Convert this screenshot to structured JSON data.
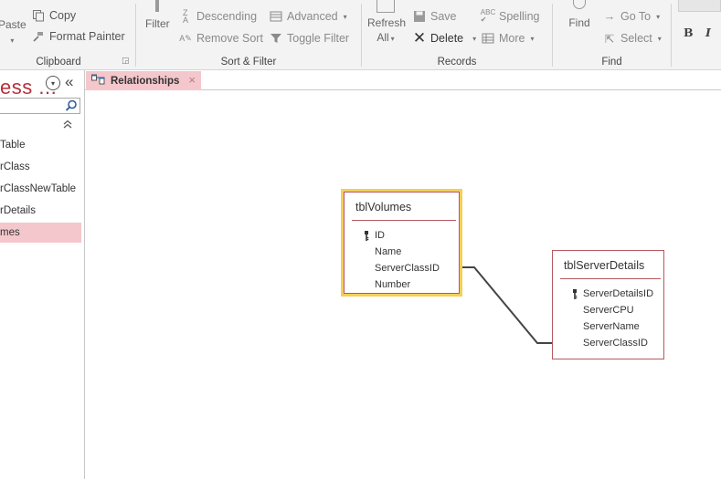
{
  "ribbon": {
    "clipboard": {
      "paste_label": "Paste",
      "copy_label": "Copy",
      "format_painter_label": "Format Painter",
      "group_label": "Clipboard"
    },
    "sort_filter": {
      "filter_label": "Filter",
      "descending_label": "Descending",
      "remove_sort_label": "Remove Sort",
      "advanced_label": "Advanced",
      "toggle_filter_label": "Toggle Filter",
      "group_label": "Sort & Filter"
    },
    "records": {
      "refresh_label": "Refresh",
      "refresh_all_label": "All",
      "save_label": "Save",
      "delete_label": "Delete",
      "spelling_label": "Spelling",
      "more_label": "More",
      "group_label": "Records"
    },
    "find": {
      "find_label": "Find",
      "goto_label": "Go To",
      "select_label": "Select",
      "group_label": "Find"
    },
    "text_formatting": {
      "bold_label": "B",
      "italic_label": "I"
    }
  },
  "nav": {
    "title": "ess ...",
    "items": [
      {
        "label": "Table",
        "selected": false
      },
      {
        "label": "rClass",
        "selected": false
      },
      {
        "label": "rClassNewTable",
        "selected": false
      },
      {
        "label": "rDetails",
        "selected": false
      },
      {
        "label": "mes",
        "selected": true
      }
    ]
  },
  "tab": {
    "label": "Relationships",
    "close_glyph": "×"
  },
  "relationships": {
    "tables": [
      {
        "name": "tblVolumes",
        "selected": true,
        "fields": [
          {
            "name": "ID",
            "key": true
          },
          {
            "name": "Name",
            "key": false
          },
          {
            "name": "ServerClassID",
            "key": false
          },
          {
            "name": "Number",
            "key": false
          }
        ]
      },
      {
        "name": "tblServerDetails",
        "selected": false,
        "fields": [
          {
            "name": "ServerDetailsID",
            "key": true
          },
          {
            "name": "ServerCPU",
            "key": false
          },
          {
            "name": "ServerName",
            "key": false
          },
          {
            "name": "ServerClassID",
            "key": false
          }
        ]
      }
    ],
    "links": [
      {
        "from_table": "tblVolumes",
        "from_field": "ServerClassID",
        "to_table": "tblServerDetails",
        "to_field": "ServerClassID"
      }
    ]
  },
  "colors": {
    "accent": "#b5303a",
    "selection_fill": "#f4c7cc",
    "table_border": "#b6585f",
    "selected_table_border": "#f5ce59",
    "ribbon_bg": "#f3f3f3"
  }
}
